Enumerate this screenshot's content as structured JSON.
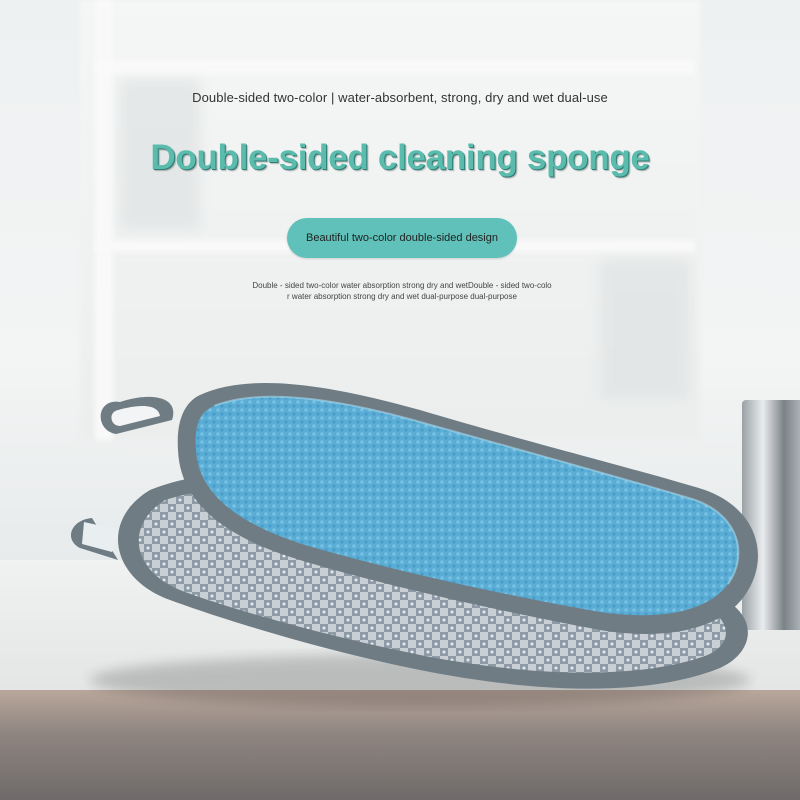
{
  "subtitle": "Double-sided two-color | water-absorbent, strong, dry and wet dual-use",
  "headline": "Double-sided cleaning sponge",
  "pill_label": "Beautiful two-color double-sided design",
  "description_line1": "Double - sided two-color water absorption strong dry and wetDouble - sided two-colo",
  "description_line2": "r water absorption strong dry and wet dual-purpose dual-purpose",
  "colors": {
    "accent": "#5fc1b9",
    "headline": "#5bbcae",
    "sponge_blue": "#5aaed6",
    "sponge_border": "#6f7c84",
    "scrub_silver": "#b7c0c8"
  }
}
